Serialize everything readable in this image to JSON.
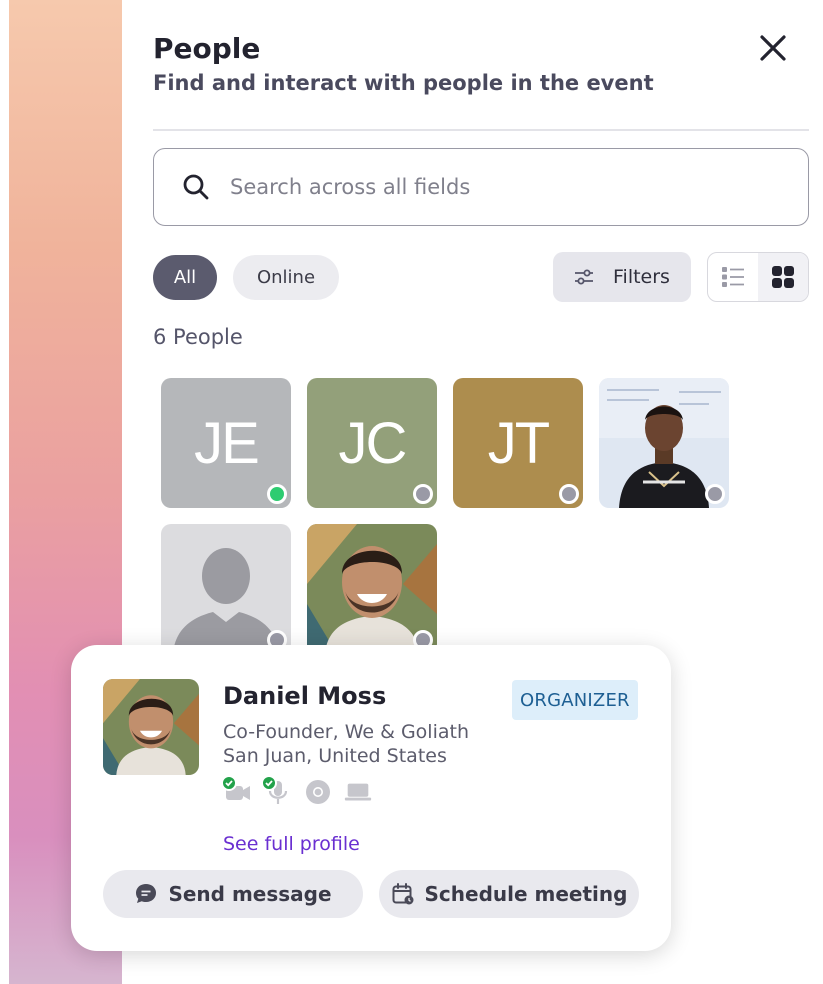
{
  "panel": {
    "title": "People",
    "subtitle": "Find and interact with people in the event"
  },
  "search": {
    "placeholder": "Search across all fields"
  },
  "filter_chips": {
    "all_label": "All",
    "online_label": "Online",
    "selected": "All"
  },
  "toolbar": {
    "filters_label": "Filters",
    "view_mode": "grid"
  },
  "people_count": "6 People",
  "people": [
    {
      "initials": "JE",
      "bg": "#b5b7ba",
      "status": "online"
    },
    {
      "initials": "JC",
      "bg": "#93a07a",
      "status": "offline"
    },
    {
      "initials": "JT",
      "bg": "#ad8d4e",
      "status": "offline"
    },
    {
      "initials": "",
      "photo": "speaker-photo",
      "status": "offline"
    },
    {
      "initials": "",
      "photo": "default-avatar",
      "status": "offline"
    },
    {
      "initials": "",
      "photo": "daniel-photo",
      "status": "offline"
    }
  ],
  "profile_card": {
    "name": "Daniel Moss",
    "badge": "ORGANIZER",
    "role": "Co-Founder, We & Goliath",
    "location": "San Juan, United States",
    "devices": [
      {
        "icon": "camera-icon",
        "enabled": true
      },
      {
        "icon": "microphone-icon",
        "enabled": true
      },
      {
        "icon": "browser-icon",
        "enabled": false
      },
      {
        "icon": "laptop-icon",
        "enabled": false
      }
    ],
    "see_profile_label": "See full profile",
    "send_message_label": "Send message",
    "schedule_meeting_label": "Schedule meeting"
  },
  "colors": {
    "online": "#2ecc71",
    "offline": "#9a9aa6",
    "link": "#6a2fd1",
    "badge_bg": "#ddeefa"
  }
}
